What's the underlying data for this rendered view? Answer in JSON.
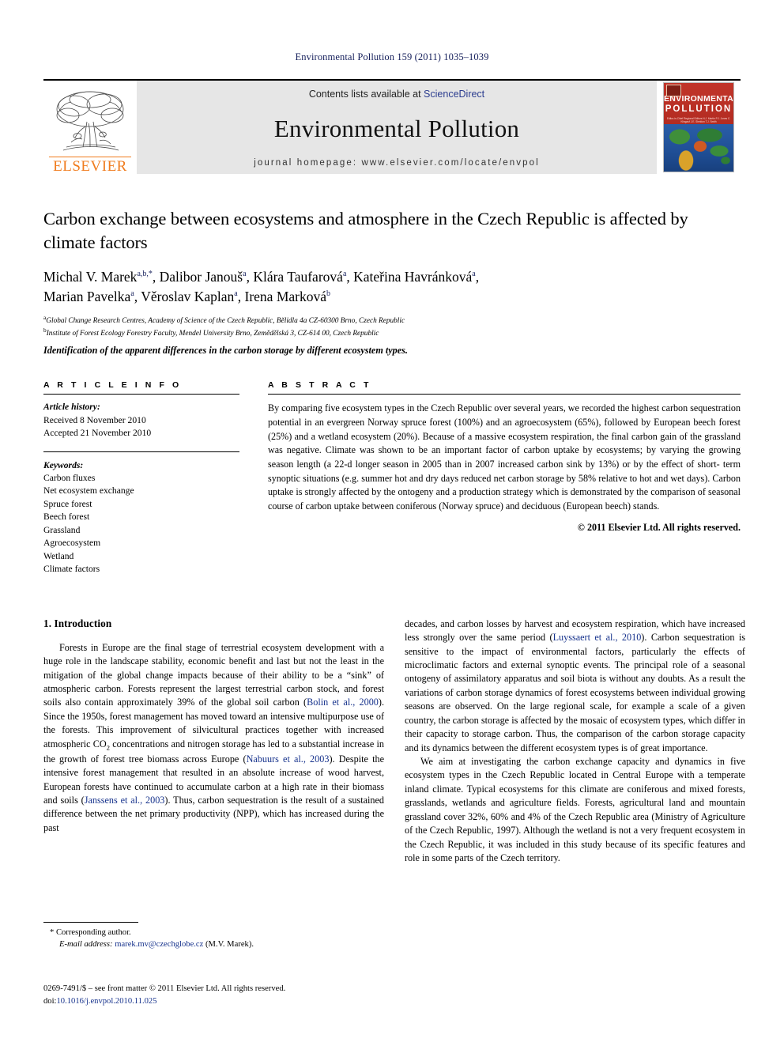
{
  "running_head": "Environmental Pollution 159 (2011) 1035–1039",
  "masthead": {
    "contents_prefix": "Contents lists available at ",
    "sciencedirect": "ScienceDirect",
    "journal_name": "Environmental Pollution",
    "homepage": "journal homepage: www.elsevier.com/locate/envpol",
    "publisher_name": "ELSEVIER",
    "cover": {
      "title_line1": "ENVIRONMENTAL",
      "title_line2": "POLLUTION",
      "editor_names": "Editor-in-Chief    Regional Editors\nN.J. Martin    P.J. Jones   C. Klingauf\n                      J.E. Sheldon   T.J. Smith"
    }
  },
  "article": {
    "title": "Carbon exchange between ecosystems and atmosphere in the Czech Republic is affected by climate factors",
    "authors_line1": "Michal V. Marek",
    "authors": [
      {
        "name": "Michal V. Marek",
        "sup": "a,b,*"
      },
      {
        "name": "Dalibor Janouš",
        "sup": "a"
      },
      {
        "name": "Klára Taufarová",
        "sup": "a"
      },
      {
        "name": "Kateřina Havránková",
        "sup": "a"
      },
      {
        "name": "Marian Pavelka",
        "sup": "a"
      },
      {
        "name": "Věroslav Kaplan",
        "sup": "a"
      },
      {
        "name": "Irena Marková",
        "sup": "b"
      }
    ],
    "affiliation_a_sup": "a",
    "affiliation_a": "Global Change Research Centres, Academy of Science of the Czech Republic, Bělidla 4a CZ-60300 Brno, Czech Republic",
    "affiliation_b_sup": "b",
    "affiliation_b": "Institute of Forest Ecology Forestry Faculty, Mendel University Brno, Zemědělská 3, CZ-614 00, Czech Republic",
    "highlight": "Identification of the apparent differences in the carbon storage by different ecosystem types."
  },
  "article_info": {
    "heading": "A R T I C L E   I N F O",
    "history_label": "Article history:",
    "received": "Received 8 November 2010",
    "accepted": "Accepted 21 November 2010",
    "keywords_label": "Keywords:",
    "keywords": [
      "Carbon fluxes",
      "Net ecosystem exchange",
      "Spruce forest",
      "Beech forest",
      "Grassland",
      "Agroecosystem",
      "Wetland",
      "Climate factors"
    ]
  },
  "abstract": {
    "heading": "A B S T R A C T",
    "text": "By comparing five ecosystem types in the Czech Republic over several years, we recorded the highest carbon sequestration potential in an evergreen Norway spruce forest (100%) and an agroecosystem (65%), followed by European beech forest (25%) and a wetland ecosystem (20%). Because of a massive ecosystem respiration, the final carbon gain of the grassland was negative. Climate was shown to be an important factor of carbon uptake by ecosystems; by varying the growing season length (a 22-d longer season in 2005 than in 2007 increased carbon sink by 13%) or by the effect of short- term synoptic situations (e.g. summer hot and dry days reduced net carbon storage by 58% relative to hot and wet days). Carbon uptake is strongly affected by the ontogeny and a production strategy which is demonstrated by the comparison of seasonal course of carbon uptake between coniferous (Norway spruce) and deciduous (European beech) stands.",
    "copyright": "© 2011 Elsevier Ltd. All rights reserved."
  },
  "introduction": {
    "heading": "1.  Introduction",
    "left_para_1_pre": "Forests in Europe are the final stage of terrestrial ecosystem development with a huge role in the landscape stability, economic benefit and last but not the least in the mitigation of the global change impacts because of their ability to be a “sink” of atmospheric carbon. Forests represent the largest terrestrial carbon stock, and forest soils also contain approximately 39% of the global soil carbon (",
    "ref_bolin": "Bolin et al., 2000",
    "left_para_1_mid": "). Since the 1950s, forest management has moved toward an intensive multipurpose use of the forests. This improvement of silvicultural practices together with increased atmospheric CO",
    "co2_sub": "2",
    "left_para_1_mid2": " concentrations and nitrogen storage has led to a substantial increase in the growth of forest tree biomass across Europe (",
    "ref_nabuurs": "Nabuurs et al., 2003",
    "left_para_1_mid3": "). Despite the intensive forest management that resulted in an absolute increase of wood harvest, European forests have continued to accumulate carbon at a high rate in their biomass and soils (",
    "ref_janssens": "Janssens et al., 2003",
    "left_para_1_end": "). Thus, carbon sequestration is the result of a sustained difference between the net primary productivity (NPP), which has increased during the past",
    "right_para_1_pre": "decades, and carbon losses by harvest and ecosystem respiration, which have increased less strongly over the same period (",
    "ref_luyssaert": "Luyssaert et al., 2010",
    "right_para_1_end": "). Carbon sequestration is sensitive to the impact of environmental factors, particularly the effects of microclimatic factors and external synoptic events. The principal role of a seasonal ontogeny of assimilatory apparatus and soil biota is without any doubts. As a result the variations of carbon storage dynamics of forest ecosystems between individual growing seasons are observed. On the large regional scale, for example a scale of a given country, the carbon storage is affected by the mosaic of ecosystem types, which differ in their capacity to storage carbon. Thus, the comparison of the carbon storage capacity and its dynamics between the different ecosystem types is of great importance.",
    "right_para_2": "We aim at investigating the carbon exchange capacity and dynamics in five ecosystem types in the Czech Republic located in Central Europe with a temperate inland climate. Typical ecosystems for this climate are coniferous and mixed forests, grasslands, wetlands and agriculture fields. Forests, agricultural land and mountain grassland cover 32%, 60% and 4% of the Czech Republic area (Ministry of Agriculture of the Czech Republic, 1997). Although the wetland is not a very frequent ecosystem in the Czech Republic, it was included in this study because of its specific features and role in some parts of the Czech territory."
  },
  "footnote": {
    "corresponding": "* Corresponding author.",
    "email_label": "E-mail address:",
    "email": "marek.mv@czechglobe.cz",
    "email_attrib": " (M.V. Marek)."
  },
  "imprint": {
    "line1": "0269-7491/$ – see front matter © 2011 Elsevier Ltd. All rights reserved.",
    "doi_label": "doi:",
    "doi": "10.1016/j.envpol.2010.11.025"
  }
}
